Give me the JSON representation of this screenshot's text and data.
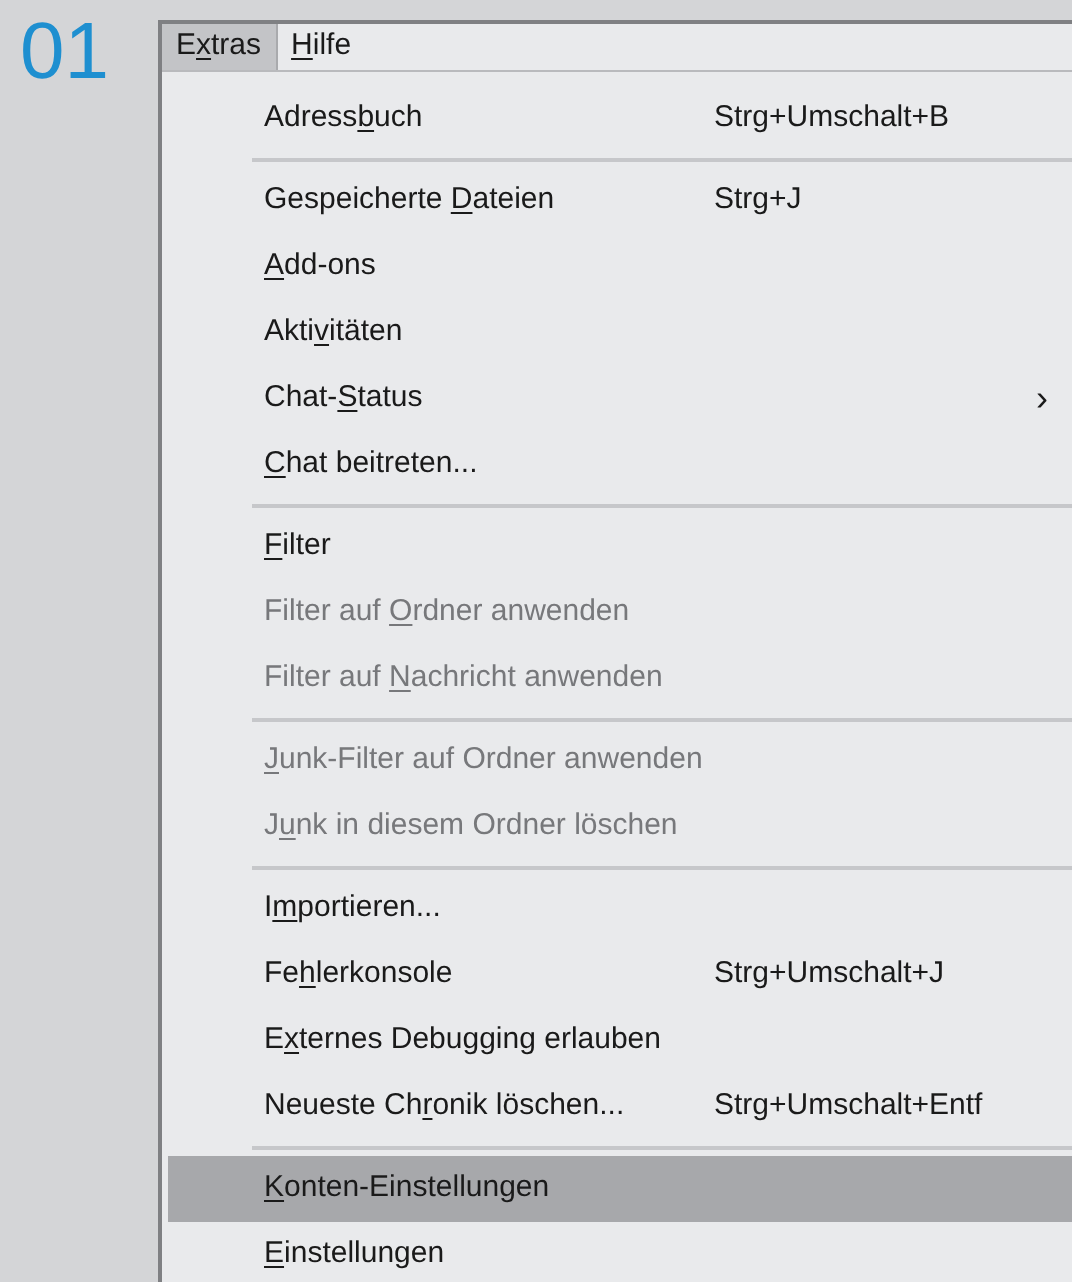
{
  "step_number": "01",
  "menubar": [
    {
      "label": {
        "pre": "E",
        "key": "x",
        "post": "tras"
      },
      "selected": true
    },
    {
      "label": {
        "key": "H",
        "post": "ilfe"
      },
      "selected": false
    }
  ],
  "menu_items": [
    {
      "kind": "item",
      "label": {
        "pre": "Adress",
        "key": "b",
        "post": "uch"
      },
      "shortcut": "Strg+Umschalt+B",
      "disabled": false,
      "selected": false
    },
    {
      "kind": "separator"
    },
    {
      "kind": "item",
      "label": {
        "pre": "Gespeicherte ",
        "key": "D",
        "post": "ateien"
      },
      "shortcut": "Strg+J",
      "disabled": false,
      "selected": false
    },
    {
      "kind": "item",
      "label": {
        "key": "A",
        "post": "dd-ons"
      },
      "disabled": false,
      "selected": false
    },
    {
      "kind": "item",
      "label": {
        "pre": "Akti",
        "key": "v",
        "post": "itäten"
      },
      "disabled": false,
      "selected": false
    },
    {
      "kind": "item",
      "label": {
        "pre": "Chat-",
        "key": "S",
        "post": "tatus"
      },
      "submenu_arrow": "›",
      "disabled": false,
      "selected": false
    },
    {
      "kind": "item",
      "label": {
        "key": "C",
        "post": "hat beitreten..."
      },
      "disabled": false,
      "selected": false
    },
    {
      "kind": "separator"
    },
    {
      "kind": "item",
      "label": {
        "key": "F",
        "post": "ilter"
      },
      "disabled": false,
      "selected": false
    },
    {
      "kind": "item",
      "label": {
        "pre": "Filter auf ",
        "key": "O",
        "post": "rdner anwenden"
      },
      "disabled": true,
      "selected": false
    },
    {
      "kind": "item",
      "label": {
        "pre": "Filter auf ",
        "key": "N",
        "post": "achricht anwenden"
      },
      "disabled": true,
      "selected": false
    },
    {
      "kind": "separator"
    },
    {
      "kind": "item",
      "label": {
        "key": "J",
        "post": "unk-Filter auf Ordner anwenden"
      },
      "disabled": true,
      "selected": false
    },
    {
      "kind": "item",
      "label": {
        "pre": "J",
        "key": "u",
        "post": "nk in diesem Ordner löschen"
      },
      "disabled": true,
      "selected": false
    },
    {
      "kind": "separator"
    },
    {
      "kind": "item",
      "label": {
        "pre": "I",
        "key": "m",
        "post": "portieren..."
      },
      "disabled": false,
      "selected": false
    },
    {
      "kind": "item",
      "label": {
        "pre": "Fe",
        "key": "h",
        "post": "lerkonsole"
      },
      "shortcut": "Strg+Umschalt+J",
      "disabled": false,
      "selected": false
    },
    {
      "kind": "item",
      "label": {
        "pre": "E",
        "key": "x",
        "post": "ternes Debugging erlauben"
      },
      "disabled": false,
      "selected": false
    },
    {
      "kind": "item",
      "label": {
        "pre": "Neueste Ch",
        "key": "r",
        "post": "onik löschen..."
      },
      "shortcut": "Strg+Umschalt+Entf",
      "disabled": false,
      "selected": false
    },
    {
      "kind": "separator"
    },
    {
      "kind": "item",
      "label": {
        "key": "K",
        "post": "onten-Einstellungen"
      },
      "disabled": false,
      "selected": true
    },
    {
      "kind": "item",
      "label": {
        "key": "E",
        "post": "instellungen"
      },
      "disabled": false,
      "selected": false
    }
  ]
}
